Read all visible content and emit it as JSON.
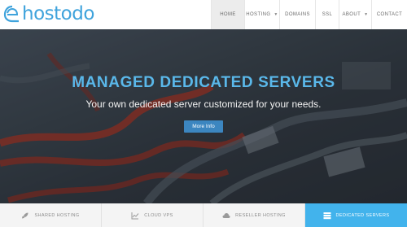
{
  "brand": {
    "name": "hostodo",
    "color": "#3fa3dc"
  },
  "nav": {
    "items": [
      {
        "label": "HOME",
        "active": true
      },
      {
        "label": "HOSTING",
        "dropdown": true
      },
      {
        "label": "DOMAINS"
      },
      {
        "label": "SSL"
      },
      {
        "label": "ABOUT",
        "dropdown": true
      },
      {
        "label": "CONTACT"
      }
    ]
  },
  "hero": {
    "title": "MANAGED DEDICATED SERVERS",
    "subtitle": "Your own dedicated server customized for your needs.",
    "button_label": "More Info",
    "title_color": "#5ab8ea",
    "button_color": "#3c86c0"
  },
  "tabs": {
    "items": [
      {
        "label": "SHARED HOSTING",
        "icon": "rocket-icon"
      },
      {
        "label": "CLOUD VPS",
        "icon": "chart-line-icon"
      },
      {
        "label": "RESELLER HOSTING",
        "icon": "cloud-icon"
      },
      {
        "label": "DEDICATED SERVERS",
        "icon": "server-icon",
        "active": true
      }
    ],
    "active_color": "#42b3ec"
  }
}
